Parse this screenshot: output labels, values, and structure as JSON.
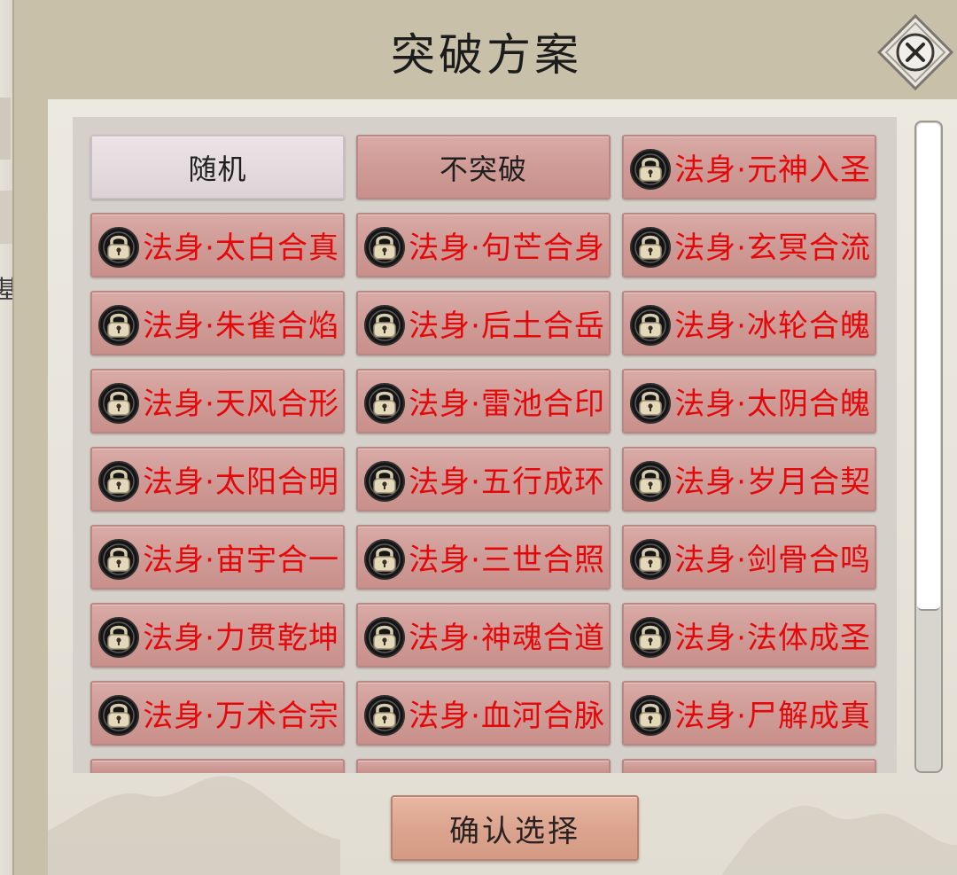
{
  "dialog": {
    "title": "突破方案",
    "confirm_label": "确认选择",
    "close_icon": "close-icon"
  },
  "background": {
    "left_char": "基"
  },
  "options": [
    {
      "label": "随机",
      "locked": false,
      "style": "random"
    },
    {
      "label": "不突破",
      "locked": false,
      "style": "plain"
    },
    {
      "label": "法身·元神入圣",
      "locked": true
    },
    {
      "label": "法身·太白合真",
      "locked": true
    },
    {
      "label": "法身·句芒合身",
      "locked": true
    },
    {
      "label": "法身·玄冥合流",
      "locked": true
    },
    {
      "label": "法身·朱雀合焰",
      "locked": true
    },
    {
      "label": "法身·后土合岳",
      "locked": true
    },
    {
      "label": "法身·冰轮合魄",
      "locked": true
    },
    {
      "label": "法身·天风合形",
      "locked": true
    },
    {
      "label": "法身·雷池合印",
      "locked": true
    },
    {
      "label": "法身·太阴合魄",
      "locked": true
    },
    {
      "label": "法身·太阳合明",
      "locked": true
    },
    {
      "label": "法身·五行成环",
      "locked": true
    },
    {
      "label": "法身·岁月合契",
      "locked": true
    },
    {
      "label": "法身·宙宇合一",
      "locked": true
    },
    {
      "label": "法身·三世合照",
      "locked": true
    },
    {
      "label": "法身·剑骨合鸣",
      "locked": true
    },
    {
      "label": "法身·力贯乾坤",
      "locked": true
    },
    {
      "label": "法身·神魂合道",
      "locked": true
    },
    {
      "label": "法身·法体成圣",
      "locked": true
    },
    {
      "label": "法身·万术合宗",
      "locked": true
    },
    {
      "label": "法身·血河合脉",
      "locked": true
    },
    {
      "label": "法身·尸解成真",
      "locked": true
    }
  ],
  "colors": {
    "locked_text": "#e5080b",
    "option_bg": "#cf9b96",
    "panel_bg": "#ece9e1"
  },
  "scroll": {
    "thumb_fraction": 0.75
  }
}
